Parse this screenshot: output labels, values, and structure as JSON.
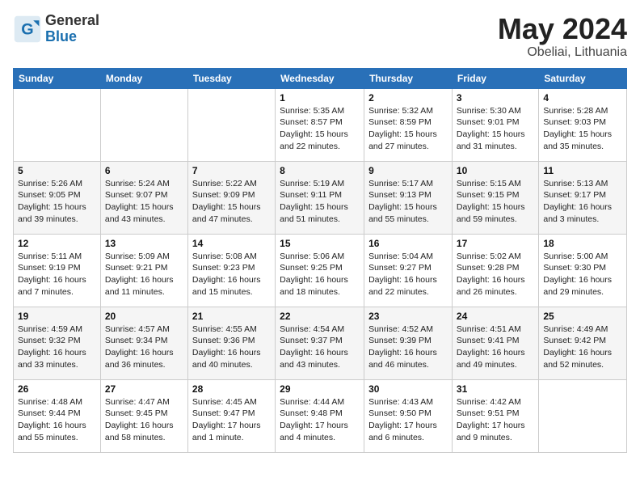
{
  "logo": {
    "general": "General",
    "blue": "Blue"
  },
  "title": {
    "month": "May 2024",
    "location": "Obeliai, Lithuania"
  },
  "headers": [
    "Sunday",
    "Monday",
    "Tuesday",
    "Wednesday",
    "Thursday",
    "Friday",
    "Saturday"
  ],
  "weeks": [
    [
      {
        "day": "",
        "info": ""
      },
      {
        "day": "",
        "info": ""
      },
      {
        "day": "",
        "info": ""
      },
      {
        "day": "1",
        "info": "Sunrise: 5:35 AM\nSunset: 8:57 PM\nDaylight: 15 hours\nand 22 minutes."
      },
      {
        "day": "2",
        "info": "Sunrise: 5:32 AM\nSunset: 8:59 PM\nDaylight: 15 hours\nand 27 minutes."
      },
      {
        "day": "3",
        "info": "Sunrise: 5:30 AM\nSunset: 9:01 PM\nDaylight: 15 hours\nand 31 minutes."
      },
      {
        "day": "4",
        "info": "Sunrise: 5:28 AM\nSunset: 9:03 PM\nDaylight: 15 hours\nand 35 minutes."
      }
    ],
    [
      {
        "day": "5",
        "info": "Sunrise: 5:26 AM\nSunset: 9:05 PM\nDaylight: 15 hours\nand 39 minutes."
      },
      {
        "day": "6",
        "info": "Sunrise: 5:24 AM\nSunset: 9:07 PM\nDaylight: 15 hours\nand 43 minutes."
      },
      {
        "day": "7",
        "info": "Sunrise: 5:22 AM\nSunset: 9:09 PM\nDaylight: 15 hours\nand 47 minutes."
      },
      {
        "day": "8",
        "info": "Sunrise: 5:19 AM\nSunset: 9:11 PM\nDaylight: 15 hours\nand 51 minutes."
      },
      {
        "day": "9",
        "info": "Sunrise: 5:17 AM\nSunset: 9:13 PM\nDaylight: 15 hours\nand 55 minutes."
      },
      {
        "day": "10",
        "info": "Sunrise: 5:15 AM\nSunset: 9:15 PM\nDaylight: 15 hours\nand 59 minutes."
      },
      {
        "day": "11",
        "info": "Sunrise: 5:13 AM\nSunset: 9:17 PM\nDaylight: 16 hours\nand 3 minutes."
      }
    ],
    [
      {
        "day": "12",
        "info": "Sunrise: 5:11 AM\nSunset: 9:19 PM\nDaylight: 16 hours\nand 7 minutes."
      },
      {
        "day": "13",
        "info": "Sunrise: 5:09 AM\nSunset: 9:21 PM\nDaylight: 16 hours\nand 11 minutes."
      },
      {
        "day": "14",
        "info": "Sunrise: 5:08 AM\nSunset: 9:23 PM\nDaylight: 16 hours\nand 15 minutes."
      },
      {
        "day": "15",
        "info": "Sunrise: 5:06 AM\nSunset: 9:25 PM\nDaylight: 16 hours\nand 18 minutes."
      },
      {
        "day": "16",
        "info": "Sunrise: 5:04 AM\nSunset: 9:27 PM\nDaylight: 16 hours\nand 22 minutes."
      },
      {
        "day": "17",
        "info": "Sunrise: 5:02 AM\nSunset: 9:28 PM\nDaylight: 16 hours\nand 26 minutes."
      },
      {
        "day": "18",
        "info": "Sunrise: 5:00 AM\nSunset: 9:30 PM\nDaylight: 16 hours\nand 29 minutes."
      }
    ],
    [
      {
        "day": "19",
        "info": "Sunrise: 4:59 AM\nSunset: 9:32 PM\nDaylight: 16 hours\nand 33 minutes."
      },
      {
        "day": "20",
        "info": "Sunrise: 4:57 AM\nSunset: 9:34 PM\nDaylight: 16 hours\nand 36 minutes."
      },
      {
        "day": "21",
        "info": "Sunrise: 4:55 AM\nSunset: 9:36 PM\nDaylight: 16 hours\nand 40 minutes."
      },
      {
        "day": "22",
        "info": "Sunrise: 4:54 AM\nSunset: 9:37 PM\nDaylight: 16 hours\nand 43 minutes."
      },
      {
        "day": "23",
        "info": "Sunrise: 4:52 AM\nSunset: 9:39 PM\nDaylight: 16 hours\nand 46 minutes."
      },
      {
        "day": "24",
        "info": "Sunrise: 4:51 AM\nSunset: 9:41 PM\nDaylight: 16 hours\nand 49 minutes."
      },
      {
        "day": "25",
        "info": "Sunrise: 4:49 AM\nSunset: 9:42 PM\nDaylight: 16 hours\nand 52 minutes."
      }
    ],
    [
      {
        "day": "26",
        "info": "Sunrise: 4:48 AM\nSunset: 9:44 PM\nDaylight: 16 hours\nand 55 minutes."
      },
      {
        "day": "27",
        "info": "Sunrise: 4:47 AM\nSunset: 9:45 PM\nDaylight: 16 hours\nand 58 minutes."
      },
      {
        "day": "28",
        "info": "Sunrise: 4:45 AM\nSunset: 9:47 PM\nDaylight: 17 hours\nand 1 minute."
      },
      {
        "day": "29",
        "info": "Sunrise: 4:44 AM\nSunset: 9:48 PM\nDaylight: 17 hours\nand 4 minutes."
      },
      {
        "day": "30",
        "info": "Sunrise: 4:43 AM\nSunset: 9:50 PM\nDaylight: 17 hours\nand 6 minutes."
      },
      {
        "day": "31",
        "info": "Sunrise: 4:42 AM\nSunset: 9:51 PM\nDaylight: 17 hours\nand 9 minutes."
      },
      {
        "day": "",
        "info": ""
      }
    ]
  ]
}
